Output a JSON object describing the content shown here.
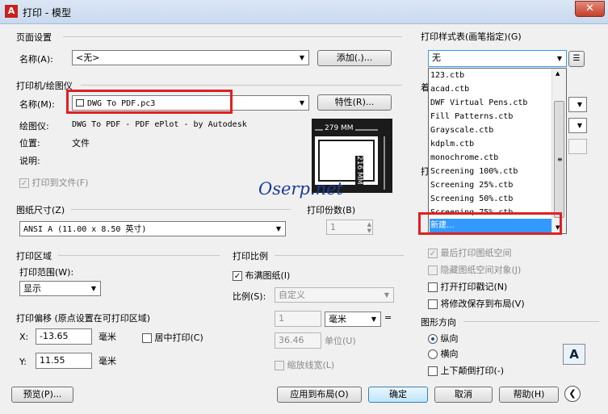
{
  "window": {
    "title": "打印 - 模型",
    "close": "✕"
  },
  "page_setup": {
    "group_label": "页面设置",
    "name_label": "名称(A):",
    "name_value": "<无>",
    "add_button": "添加(.)..."
  },
  "printer": {
    "group_label": "打印机/绘图仪",
    "name_label": "名称(M):",
    "name_value": "DWG To PDF.pc3",
    "properties_button": "特性(R)...",
    "plotter_label": "绘图仪:",
    "plotter_value": "DWG To PDF - PDF ePlot - by Autodesk",
    "location_label": "位置:",
    "location_value": "文件",
    "description_label": "说明:",
    "print_to_file_label": "打印到文件(F)",
    "preview_width": "279 MM",
    "preview_height": "216 MM"
  },
  "watermark": "Oserp.net",
  "paper_size": {
    "group_label": "图纸尺寸(Z)",
    "value": "ANSI A (11.00 x 8.50 英寸)"
  },
  "copies": {
    "group_label": "打印份数(B)",
    "value": "1"
  },
  "plot_area": {
    "group_label": "打印区域",
    "range_label": "打印范围(W):",
    "range_value": "显示"
  },
  "plot_offset": {
    "group_label": "打印偏移 (原点设置在可打印区域)",
    "x_label": "X:",
    "x_value": "-13.65",
    "x_unit": "毫米",
    "y_label": "Y:",
    "y_value": "11.55",
    "y_unit": "毫米",
    "center_label": "居中打印(C)"
  },
  "plot_scale": {
    "group_label": "打印比例",
    "fit_label": "布满图纸(I)",
    "scale_label": "比例(S):",
    "scale_value": "自定义",
    "value1": "1",
    "unit_value": "毫米",
    "equals": "=",
    "value2": "36.46",
    "unit2_label": "单位(U)",
    "lineweights_label": "缩放线宽(L)"
  },
  "style_table": {
    "group_label": "打印样式表(画笔指定)(G)",
    "selected": "无",
    "items": [
      "123.ctb",
      "acad.ctb",
      "DWF Virtual Pens.ctb",
      "Fill Patterns.ctb",
      "Grayscale.ctb",
      "kdplm.ctb",
      "monochrome.ctb",
      "Screening 100%.ctb",
      "Screening 25%.ctb",
      "Screening 50%.ctb",
      "Screening 75%.ctb",
      "新建..."
    ],
    "highlighted_index": 11
  },
  "partial_labels": {
    "a": "着",
    "b": "打"
  },
  "options": {
    "last_paperspace": "最后打印图纸空间",
    "hide_objects": "隐藏图纸空间对象(J)",
    "stamp": "打开打印戳记(N)",
    "save_changes": "将修改保存到布局(V)"
  },
  "orientation": {
    "group_label": "图形方向",
    "portrait": "纵向",
    "landscape": "横向",
    "upside_down": "上下颠倒打印(-)"
  },
  "footer": {
    "preview_button": "预览(P)...",
    "apply_button": "应用到布局(O)",
    "ok_button": "确定",
    "cancel_button": "取消",
    "help_button": "帮助(H)"
  },
  "colors": {
    "accent": "#3399ff",
    "highlight_box": "#e02020",
    "title_icon": "#c8201e"
  }
}
